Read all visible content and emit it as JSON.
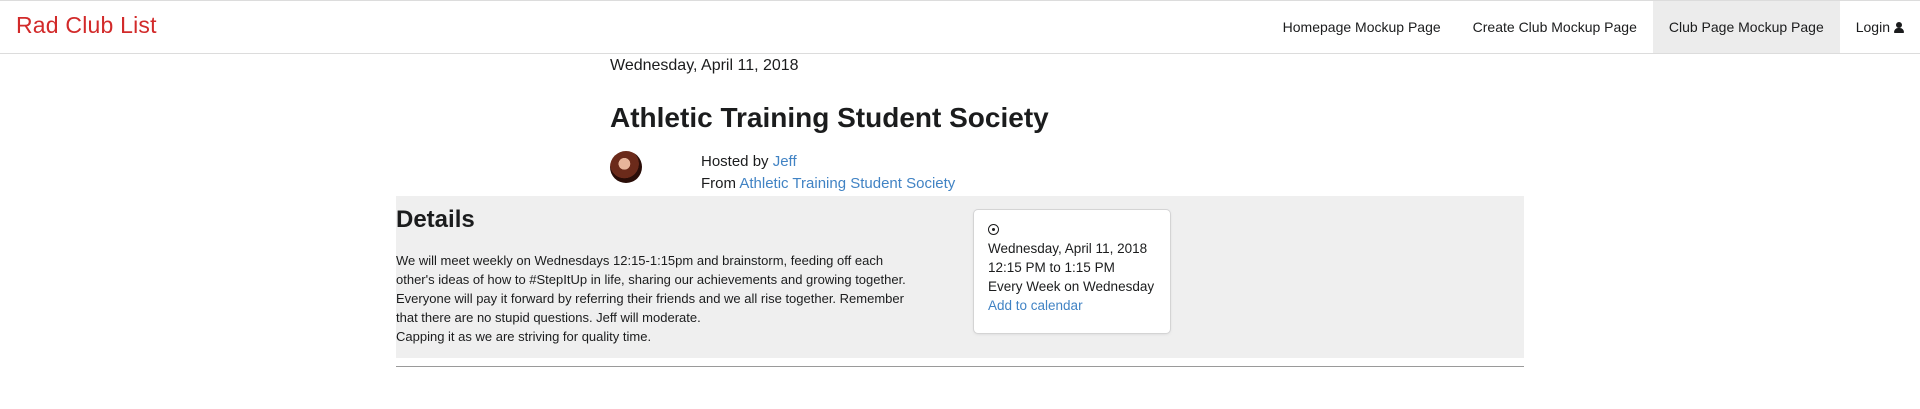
{
  "app": {
    "brand": "Rad Club List"
  },
  "nav": {
    "items": [
      {
        "label": "Homepage Mockup Page"
      },
      {
        "label": "Create Club Mockup Page"
      },
      {
        "label": "Club Page Mockup Page",
        "active": true
      },
      {
        "label": "Login",
        "icon": "user-icon"
      }
    ]
  },
  "event": {
    "date_header": "Wednesday, April 11, 2018",
    "title": "Athletic Training Student Society",
    "hosted_by_prefix": "Hosted by",
    "host_name": "Jeff",
    "from_prefix": "From",
    "club_name": "Athletic Training Student Society"
  },
  "details": {
    "heading": "Details",
    "lines": [
      "We will meet weekly on Wednesdays 12:15-1:15pm and brainstorm, feeding off each",
      "other's ideas of how to #StepItUp in life, sharing our achievements and growing together.",
      "Everyone will pay it forward by referring their friends and we all rise together. Remember",
      "that there are no stupid questions. Jeff will moderate.",
      "Capping it as we are striving for quality time."
    ]
  },
  "schedule": {
    "icon": "clock-icon",
    "date": "Wednesday, April 11, 2018",
    "time": "12:15 PM to 1:15 PM",
    "recurrence": "Every Week on Wednesday",
    "add_to_calendar": "Add to calendar"
  },
  "colors": {
    "brand": "#d22a2a",
    "link": "#4183c4",
    "band": "#efefef",
    "active_nav": "#ececec"
  }
}
